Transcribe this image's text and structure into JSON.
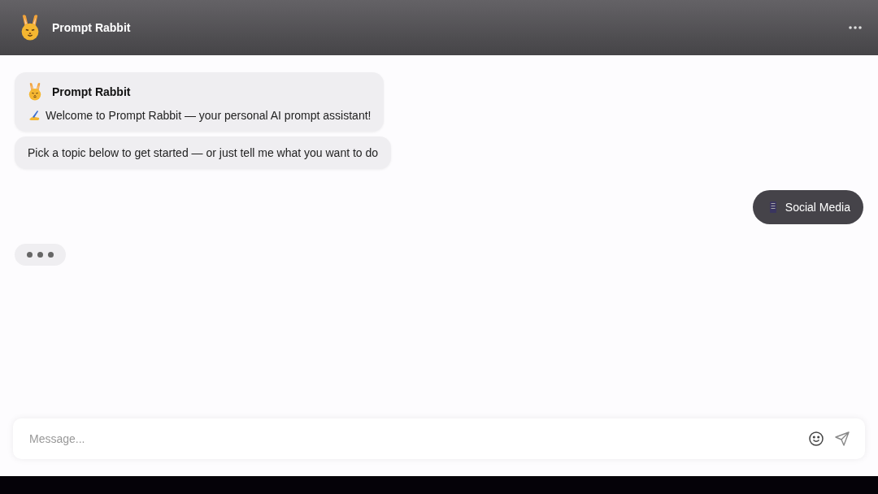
{
  "header": {
    "title": "Prompt Rabbit"
  },
  "messages": [
    {
      "kind": "bot_intro",
      "sender": "Prompt Rabbit",
      "text": "Welcome to Prompt Rabbit — your personal AI prompt assistant!"
    },
    {
      "kind": "bot",
      "text": "Pick a topic below to get started — or just tell me what you want to do"
    },
    {
      "kind": "user",
      "text": "Social Media"
    },
    {
      "kind": "typing"
    }
  ],
  "composer": {
    "placeholder": "Message..."
  }
}
